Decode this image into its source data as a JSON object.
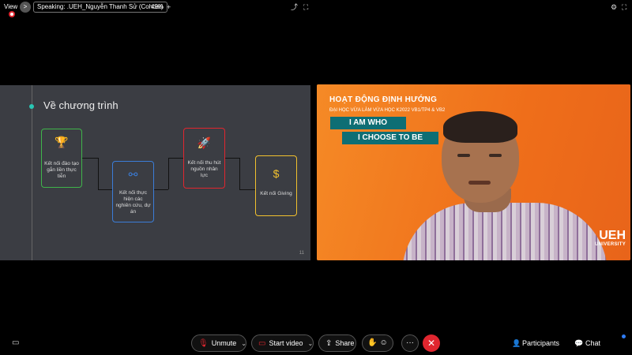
{
  "topbar": {
    "view_label": "View",
    "speaking_label": "Speaking: .UEH_Nguyễn Thanh Sử (Cohost)",
    "zoom": "49%",
    "zoom_plus": "+",
    "chev": ">",
    "icons": [
      "share-screen-icon",
      "settings-icon",
      "fullscreen-icon"
    ]
  },
  "slide": {
    "title": "Về chương trình",
    "page_number": "11",
    "cards": [
      {
        "label": "Kết nối đào tạo gắn liền thực tiễn",
        "icon": "trophy-icon",
        "color": "#3fb44a"
      },
      {
        "label": "Kết nối thực hiện các nghiên cứu, dự án",
        "icon": "network-icon",
        "color": "#3b7dd8"
      },
      {
        "label": "Kết nối thu hút nguồn nhân lực",
        "icon": "rocket-icon",
        "color": "#e0262f"
      },
      {
        "label": "Kết nối Giving",
        "icon": "coins-icon",
        "color": "#f2c12e"
      }
    ]
  },
  "video": {
    "title": "HOẠT ĐỘNG ĐỊNH HƯỚNG",
    "subtitle": "ĐẠI HỌC VỪA LÀM VỪA HỌC K2022 VB1/TP4 & VB2",
    "tag1": "I AM WHO",
    "tag2": "I CHOOSE TO BE",
    "logo_main": "UEH",
    "logo_sub": "UNIVERSITY"
  },
  "bottombar": {
    "unmute": "Unmute",
    "start_video": "Start video",
    "share": "Share",
    "participants": "Participants",
    "chat": "Chat",
    "more": "···"
  }
}
